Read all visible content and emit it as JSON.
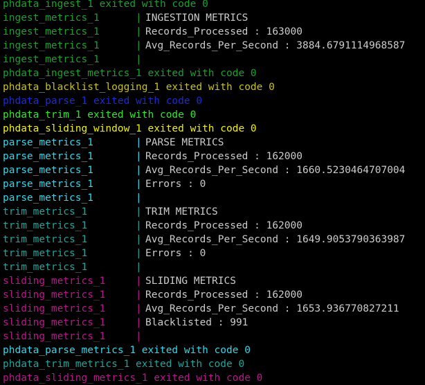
{
  "colors": {
    "ingest": "#18a030",
    "trim": "#1fa59a",
    "parse": "#2fd8e8",
    "sliding": "#b8178a",
    "blue": "#1a2bd8",
    "brightgreen": "#2ee82e",
    "yellow": "#f2f200",
    "olive": "#c7c217",
    "content": "#cccccc"
  },
  "lines": [
    {
      "type": "full",
      "text": "phdata_ingest_1 exited with code 0",
      "color": "ingest"
    },
    {
      "type": "log",
      "prefix": "ingest_metrics_1",
      "color": "ingest",
      "content": "INGESTION METRICS"
    },
    {
      "type": "log",
      "prefix": "ingest_metrics_1",
      "color": "ingest",
      "content": "Records_Processed : 163000"
    },
    {
      "type": "log",
      "prefix": "ingest_metrics_1",
      "color": "ingest",
      "content": "Avg_Records_Per_Second : 3884.6791114968587"
    },
    {
      "type": "log",
      "prefix": "ingest_metrics_1",
      "color": "ingest",
      "content": ""
    },
    {
      "type": "full",
      "text": "phdata_ingest_metrics_1 exited with code 0",
      "color": "ingest"
    },
    {
      "type": "full",
      "text": "phdata_blacklist_logging_1 exited with code 0",
      "color": "olive"
    },
    {
      "type": "full",
      "text": "phdata_parse_1 exited with code 0",
      "color": "blue"
    },
    {
      "type": "full",
      "text": "phdata_trim_1 exited with code 0",
      "color": "brightgreen"
    },
    {
      "type": "full",
      "text": "phdata_sliding_window_1 exited with code 0",
      "color": "yellow"
    },
    {
      "type": "log",
      "prefix": "parse_metrics_1",
      "color": "parse",
      "content": "PARSE METRICS"
    },
    {
      "type": "log",
      "prefix": "parse_metrics_1",
      "color": "parse",
      "content": "Records_Processed : 162000"
    },
    {
      "type": "log",
      "prefix": "parse_metrics_1",
      "color": "parse",
      "content": "Avg_Records_Per_Second : 1660.5230464707004"
    },
    {
      "type": "log",
      "prefix": "parse_metrics_1",
      "color": "parse",
      "content": "Errors : 0"
    },
    {
      "type": "log",
      "prefix": "parse_metrics_1",
      "color": "parse",
      "content": ""
    },
    {
      "type": "log",
      "prefix": "trim_metrics_1",
      "color": "trim",
      "content": "TRIM METRICS"
    },
    {
      "type": "log",
      "prefix": "trim_metrics_1",
      "color": "trim",
      "content": "Records_Processed : 162000"
    },
    {
      "type": "log",
      "prefix": "trim_metrics_1",
      "color": "trim",
      "content": "Avg_Records_Per_Second : 1649.9053790363987"
    },
    {
      "type": "log",
      "prefix": "trim_metrics_1",
      "color": "trim",
      "content": "Errors : 0"
    },
    {
      "type": "log",
      "prefix": "trim_metrics_1",
      "color": "trim",
      "content": ""
    },
    {
      "type": "log",
      "prefix": "sliding_metrics_1",
      "color": "sliding",
      "content": "SLIDING METRICS"
    },
    {
      "type": "log",
      "prefix": "sliding_metrics_1",
      "color": "sliding",
      "content": "Records_Processed : 162000"
    },
    {
      "type": "log",
      "prefix": "sliding_metrics_1",
      "color": "sliding",
      "content": "Avg_Records_Per_Second : 1653.936770827211"
    },
    {
      "type": "log",
      "prefix": "sliding_metrics_1",
      "color": "sliding",
      "content": "Blacklisted : 991"
    },
    {
      "type": "log",
      "prefix": "sliding_metrics_1",
      "color": "sliding",
      "content": ""
    },
    {
      "type": "full",
      "text": "phdata_parse_metrics_1 exited with code 0",
      "color": "parse"
    },
    {
      "type": "full",
      "text": "phdata_trim_metrics_1 exited with code 0",
      "color": "trim"
    },
    {
      "type": "full",
      "text": "phdata_sliding_metrics_1 exited with code 0",
      "color": "sliding"
    }
  ]
}
